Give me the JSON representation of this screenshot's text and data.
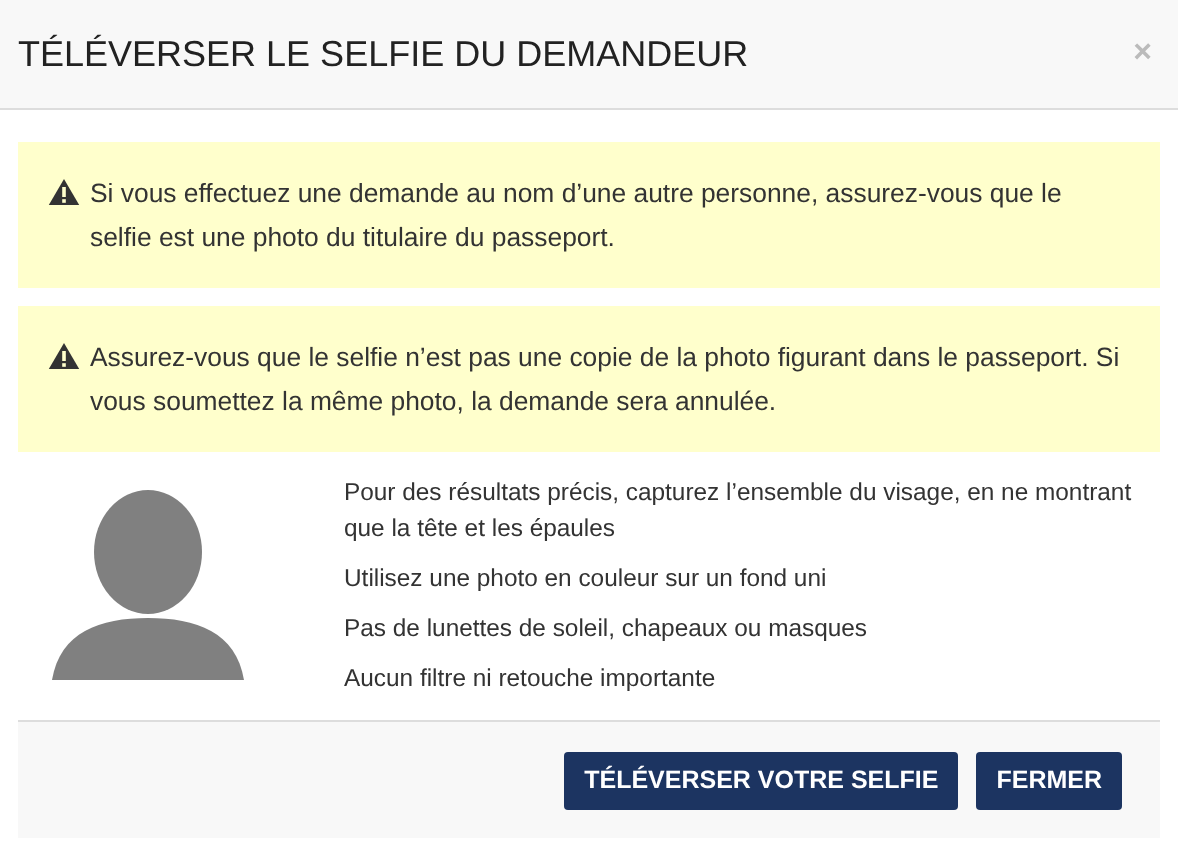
{
  "dialog": {
    "title": "TÉLÉVERSER LE SELFIE DU DEMANDEUR",
    "close": "×"
  },
  "warnings": [
    "Si vous effectuez une demande au nom d’une autre personne, assurez-vous que le selfie est une photo du titulaire du passeport.",
    "Assurez-vous que le selfie n’est pas une copie de la photo figurant dans le passeport. Si vous soumettez la même photo, la demande sera annulée."
  ],
  "guidelines": [
    "Pour des résultats précis, capturez l’ensemble du visage, en ne montrant que la tête et les épaules",
    "Utilisez une photo en couleur sur un fond uni",
    "Pas de lunettes de soleil, chapeaux ou masques",
    "Aucun filtre ni retouche importante"
  ],
  "buttons": [
    "TÉLÉVERSER VOTRE SELFIE",
    "FERMER"
  ]
}
